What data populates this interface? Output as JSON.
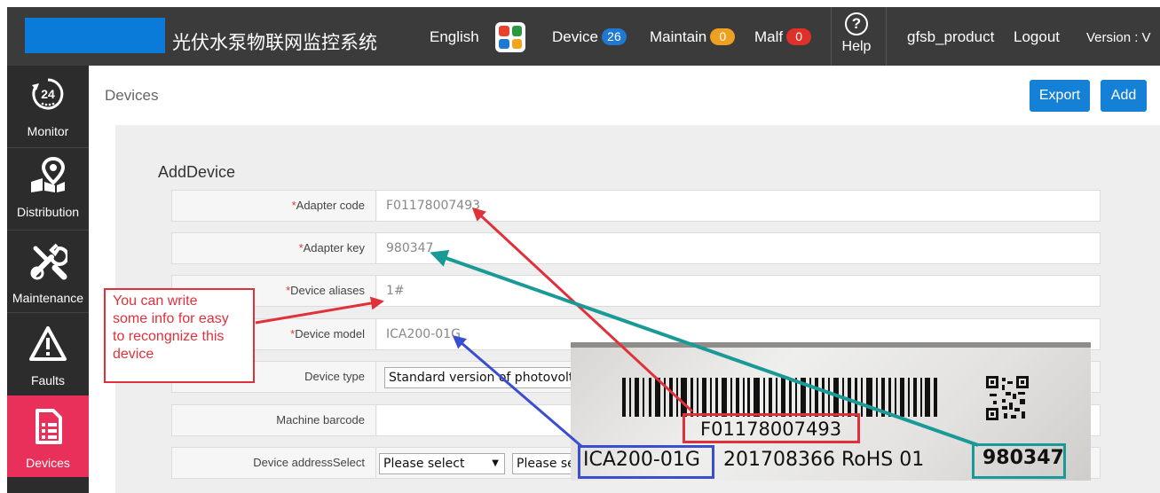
{
  "header": {
    "app_title": "光伏水泵物联网监控系统",
    "language": "English",
    "device_label": "Device",
    "device_count": "26",
    "maintain_label": "Maintain",
    "maintain_count": "0",
    "malf_label": "Malf",
    "malf_count": "0",
    "help_label": "Help",
    "username": "gfsb_product",
    "logout_label": "Logout",
    "version_label": "Version : V"
  },
  "sidebar": {
    "items": [
      {
        "label": "Monitor",
        "icon": "monitor-24h-icon"
      },
      {
        "label": "Distribution",
        "icon": "map-pin-icon"
      },
      {
        "label": "Maintenance",
        "icon": "tools-icon"
      },
      {
        "label": "Faults",
        "icon": "warning-icon"
      },
      {
        "label": "Devices",
        "icon": "document-icon",
        "active": true
      }
    ]
  },
  "page": {
    "breadcrumb": "Devices",
    "export_label": "Export",
    "add_label": "Add"
  },
  "form": {
    "title": "AddDevice",
    "required_mark": "*",
    "adapter_code": {
      "label": "Adapter code",
      "value": "F01178007493"
    },
    "adapter_key": {
      "label": "Adapter key",
      "value": "980347"
    },
    "device_aliases": {
      "label": "Device aliases",
      "value": "1#"
    },
    "device_model": {
      "label": "Device model",
      "value": "ICA200-01G"
    },
    "device_type": {
      "label": "Device type",
      "value": "Standard version of photovolta"
    },
    "machine_barcode": {
      "label": "Machine barcode",
      "value": ""
    },
    "device_address": {
      "label": "Device addressSelect",
      "select1": "Please select",
      "select2": "Please se"
    }
  },
  "annotation": {
    "lines": [
      "You can write",
      "some info for easy",
      "to recongnize this",
      "device"
    ],
    "color": "#e0303a"
  },
  "label_photo": {
    "code": "F01178007493",
    "model": "ICA200-01G",
    "serial": "201708366 RoHS 01",
    "key": "980347"
  },
  "colors": {
    "topbar": "#3b3b3b",
    "sidebar": "#2c2c2c",
    "active_nav": "#e8305a",
    "primary_button": "#1480d6",
    "arrow_red": "#e0303a",
    "arrow_teal": "#1a9a96",
    "arrow_blue": "#3a4fd0"
  }
}
